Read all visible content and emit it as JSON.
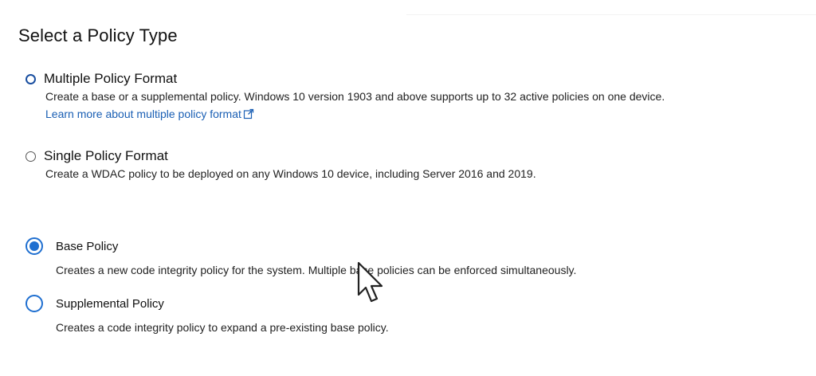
{
  "page": {
    "title": "Select a Policy Type"
  },
  "format_options": [
    {
      "label": "Multiple Policy Format",
      "description": "Create a base or a supplemental policy. Windows 10 version 1903 and above supports up to 32 active policies on one device.",
      "link": "Learn more about multiple policy format",
      "checked": true
    },
    {
      "label": "Single Policy Format",
      "description": "Create a WDAC policy to be deployed on any Windows 10 device, including Server 2016 and 2019.",
      "checked": false
    }
  ],
  "policy_options": [
    {
      "label": "Base Policy",
      "description": "Creates a new code integrity policy for the system. Multiple base policies can be enforced simultaneously.",
      "checked": true
    },
    {
      "label": "Supplemental Policy",
      "description": "Creates a code integrity policy to expand a pre-existing base policy.",
      "checked": false
    }
  ],
  "icons": {
    "link_icon": "external-link-icon",
    "cursor": "mouse-pointer-icon"
  },
  "colors": {
    "accent": "#1f6fd0",
    "link": "#1a5fb4",
    "radio_small_checked": "#1a4fa0"
  }
}
